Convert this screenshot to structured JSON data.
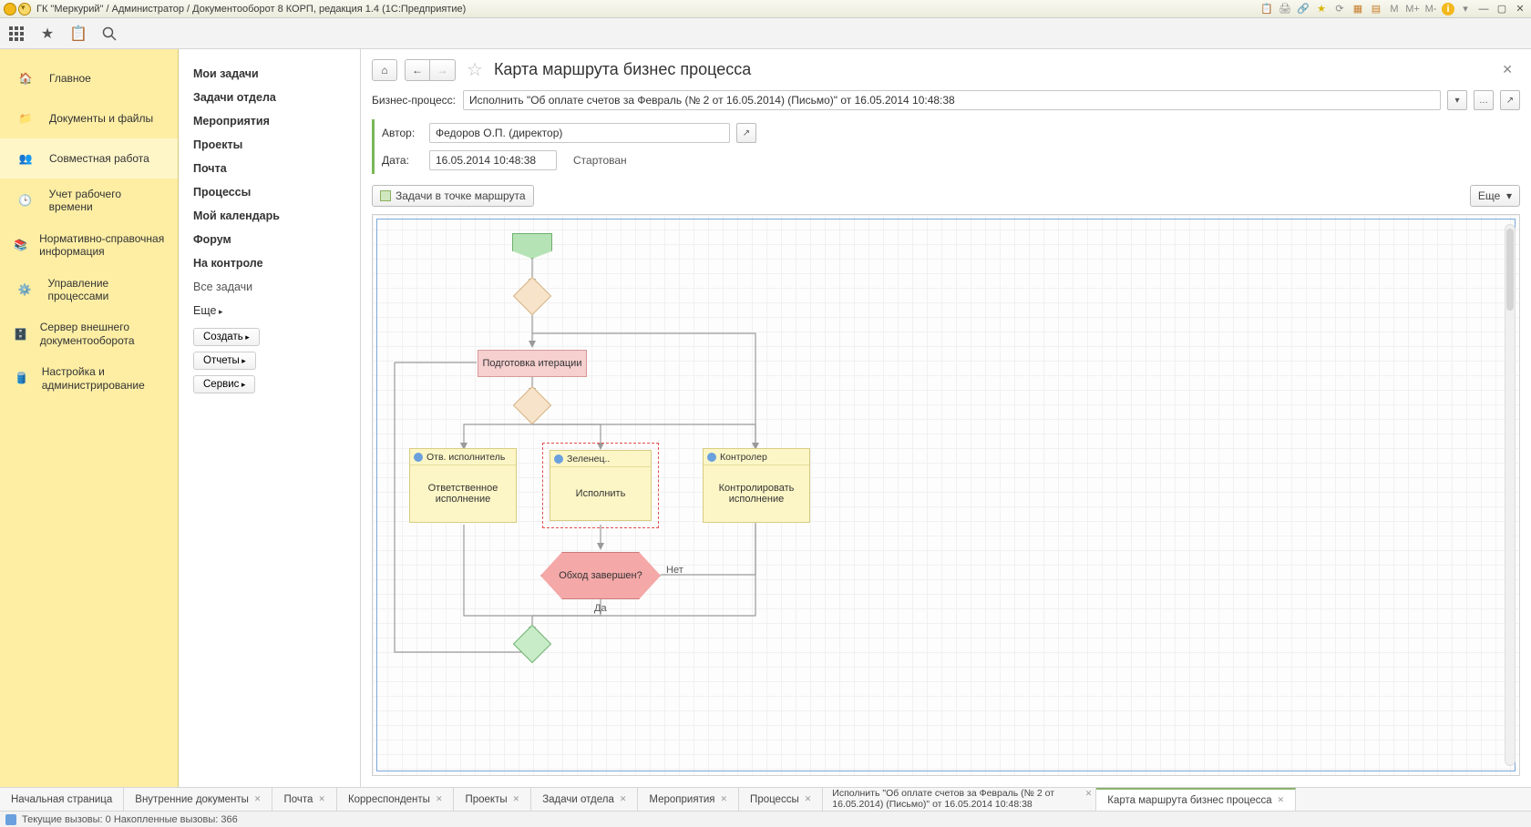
{
  "titlebar": {
    "text": "ГК \"Меркурий\" / Администратор / Документооборот 8 КОРП, редакция 1.4  (1С:Предприятие)",
    "m_labels": [
      "M",
      "M+",
      "M-"
    ]
  },
  "sidebar1": [
    {
      "label": "Главное"
    },
    {
      "label": "Документы и файлы"
    },
    {
      "label": "Совместная работа"
    },
    {
      "label": "Учет рабочего времени"
    },
    {
      "label": "Нормативно-справочная информация"
    },
    {
      "label": "Управление процессами"
    },
    {
      "label": "Сервер внешнего документооборота"
    },
    {
      "label": "Настройка и администрирование"
    }
  ],
  "sidebar2": {
    "links": [
      "Мои задачи",
      "Задачи отдела",
      "Мероприятия",
      "Проекты",
      "Почта",
      "Процессы",
      "Мой календарь",
      "Форум",
      "На контроле"
    ],
    "all_tasks": "Все задачи",
    "more": "Еще",
    "chips": [
      "Создать",
      "Отчеты",
      "Сервис"
    ]
  },
  "content": {
    "title": "Карта маршрута бизнес процесса",
    "bp_label": "Бизнес-процесс:",
    "bp_value": "Исполнить \"Об оплате счетов за Февраль (№ 2 от 16.05.2014) (Письмо)\" от 16.05.2014 10:48:38",
    "author_label": "Автор:",
    "author_value": "Федоров О.П. (директор)",
    "date_label": "Дата:",
    "date_value": "16.05.2014 10:48:38",
    "status": "Стартован",
    "route_tasks_btn": "Задачи в точке маршрута",
    "more_btn": "Еще"
  },
  "diagram": {
    "prep": "Подготовка итерации",
    "task1_role": "Отв. исполнитель",
    "task1_body": "Ответственное исполнение",
    "task2_role": "Зеленец..",
    "task2_body": "Исполнить",
    "task3_role": "Контролер",
    "task3_body": "Контролировать исполнение",
    "decision": "Обход завершен?",
    "yes": "Да",
    "no": "Нет"
  },
  "bottom_tabs": [
    "Начальная страница",
    "Внутренние документы",
    "Почта",
    "Корреспонденты",
    "Проекты",
    "Задачи отдела",
    "Мероприятия",
    "Процессы",
    "Исполнить \"Об оплате счетов за Февраль (№ 2 от 16.05.2014) (Письмо)\" от 16.05.2014 10:48:38",
    "Карта маршрута бизнес процесса"
  ],
  "statusbar": "Текущие вызовы: 0  Накопленные вызовы: 366"
}
